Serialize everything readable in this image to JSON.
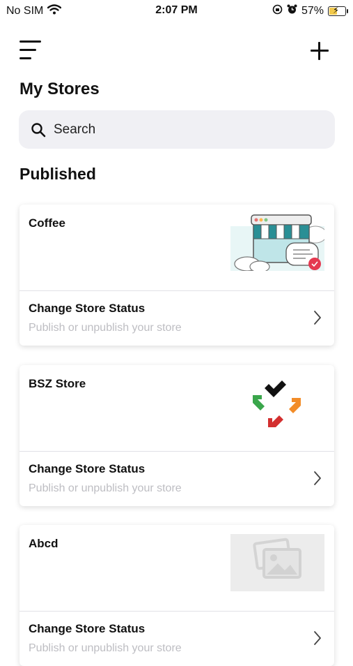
{
  "status_bar": {
    "carrier": "No SIM",
    "time": "2:07 PM",
    "battery_percent": "57%",
    "battery_level": 0.57
  },
  "header": {
    "title": "My Stores",
    "menu_icon": "menu-icon",
    "add_icon": "plus-icon"
  },
  "search": {
    "placeholder": "Search"
  },
  "section": {
    "title": "Published"
  },
  "stores": [
    {
      "name": "Coffee",
      "status_title": "Change Store Status",
      "status_subtitle": "Publish or unpublish your store",
      "image": "storefront-illustration"
    },
    {
      "name": "BSZ Store",
      "status_title": "Change Store Status",
      "status_subtitle": "Publish or unpublish your store",
      "image": "arrows-logo"
    },
    {
      "name": "Abcd",
      "status_title": "Change Store Status",
      "status_subtitle": "Publish or unpublish your store",
      "image": "placeholder-image"
    }
  ],
  "colors": {
    "search_background": "#f0f0f4",
    "subtitle_gray": "#bdbdc2",
    "battery_fill": "#f2c94c"
  }
}
